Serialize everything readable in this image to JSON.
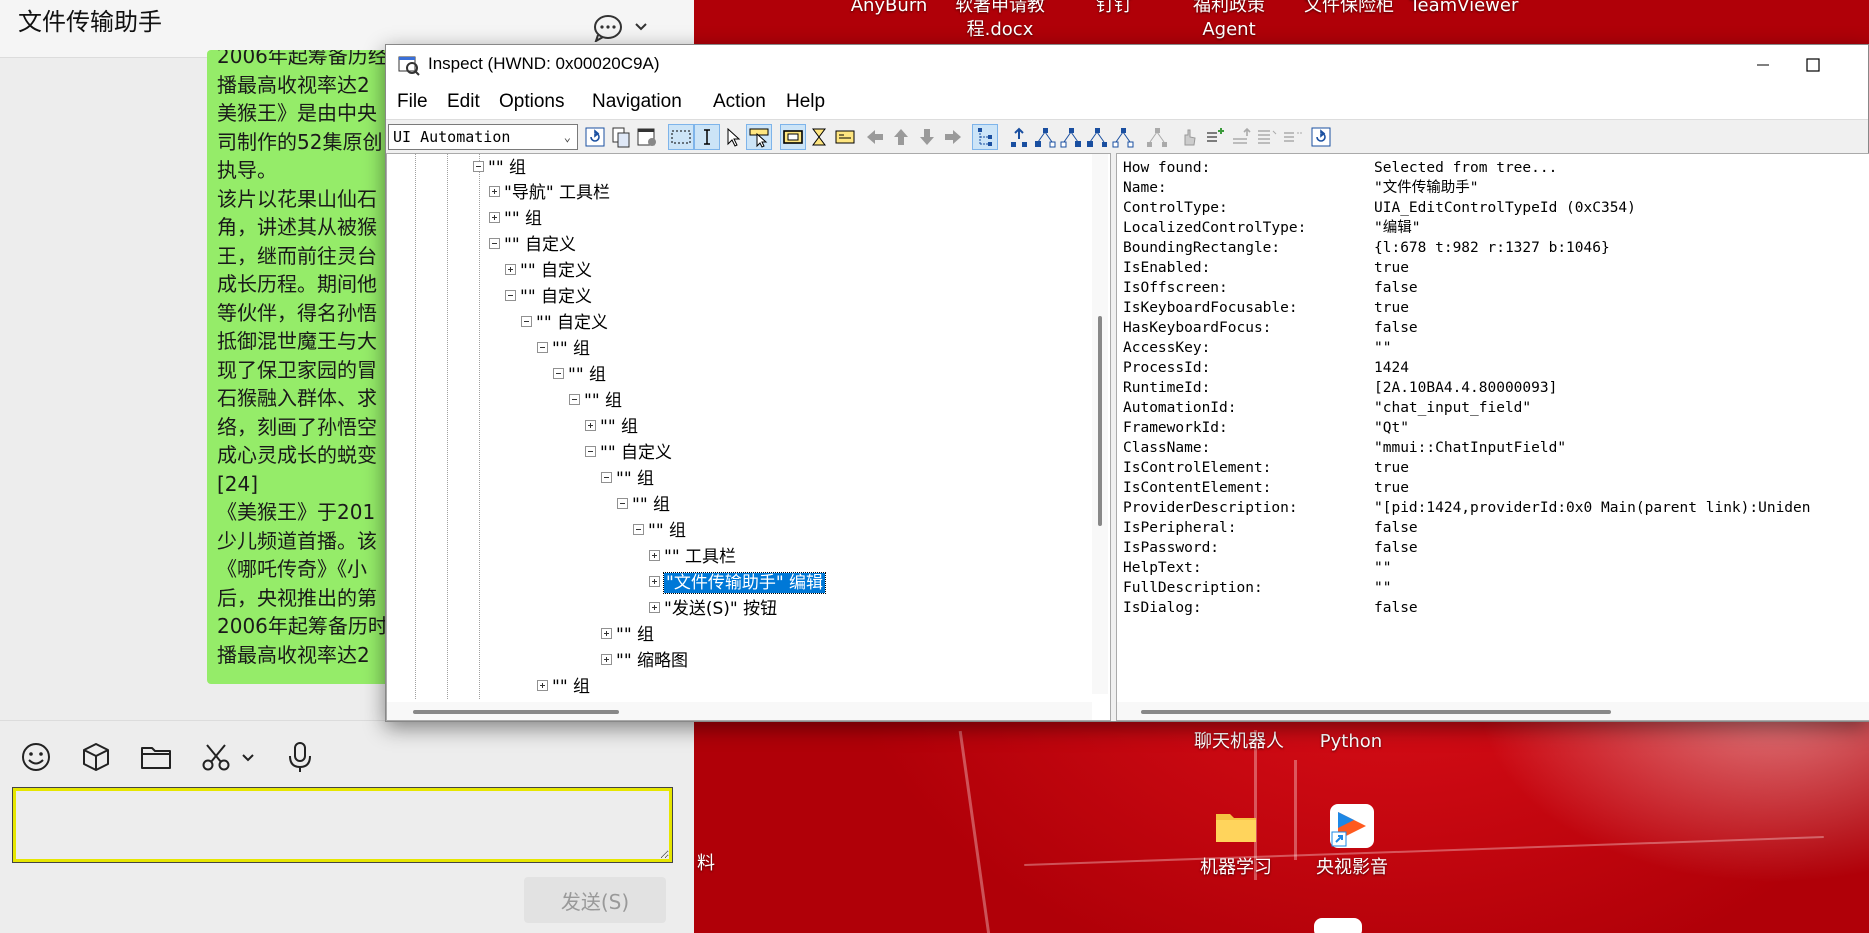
{
  "desktop": {
    "top_labels": [
      "AnyBurn",
      "软著申请教\n程.docx",
      "钉钉",
      "福利政策\nAgent",
      "文件保险柜",
      "TeamViewer"
    ],
    "mid_labels": [
      "聊天机器人",
      "Python"
    ],
    "icons": [
      {
        "label": "机器学习",
        "icon": "folder-icon"
      },
      {
        "label": "央视影音",
        "icon": "cctv-video-icon"
      }
    ],
    "partial_label": "料"
  },
  "chat": {
    "title": "文件传输助手",
    "message_text": "2006年起筹备历经\n播最高收视率达2\n美猴王》是由中央\n司制作的52集原创\n执导。\n该片以花果山仙石\n角，讲述其从被猴\n王，继而前往灵台\n成长历程。期间他\n等伙伴，得名孙悟\n抵御混世魔王与大\n现了保卫家园的冒\n石猴融入群体、求\n络，刻画了孙悟空\n成心灵成长的蜕变\n[24]\n《美猴王》于201\n少儿频道首播。该\n《哪吒传奇》《小\n后，央视推出的第\n2006年起筹备历时\n播最高收视率达2",
    "tools": [
      "emoji-icon",
      "cube-icon",
      "folder-icon",
      "scissors-icon",
      "microphone-icon"
    ],
    "input_value": "",
    "send_label": "发送(S)"
  },
  "inspect": {
    "title": "Inspect  (HWND: 0x00020C9A)",
    "menu": [
      "File",
      "Edit",
      "Options",
      "Navigation",
      "Action",
      "Help"
    ],
    "mode": "UI Automation",
    "tree": [
      {
        "label": "\"\" 组",
        "exp": "minus"
      },
      {
        "label": "\"导航\" 工具栏",
        "exp": "plus"
      },
      {
        "label": "\"\" 组",
        "exp": "plus"
      },
      {
        "label": "\"\" 自定义",
        "exp": "minus"
      },
      {
        "label": "\"\" 自定义",
        "exp": "plus"
      },
      {
        "label": "\"\" 自定义",
        "exp": "minus"
      },
      {
        "label": "\"\" 自定义",
        "exp": "minus"
      },
      {
        "label": "\"\" 组",
        "exp": "minus"
      },
      {
        "label": "\"\" 组",
        "exp": "minus"
      },
      {
        "label": "\"\" 组",
        "exp": "minus"
      },
      {
        "label": "\"\" 组",
        "exp": "plus"
      },
      {
        "label": "\"\" 自定义",
        "exp": "minus"
      },
      {
        "label": "\"\" 组",
        "exp": "minus"
      },
      {
        "label": "\"\" 组",
        "exp": "minus"
      },
      {
        "label": "\"\" 组",
        "exp": "minus"
      },
      {
        "label": "\"\" 工具栏",
        "exp": "plus"
      },
      {
        "label": "\"文件传输助手\" 编辑",
        "exp": "plus",
        "selected": true
      },
      {
        "label": "\"发送(S)\" 按钮",
        "exp": "plus"
      },
      {
        "label": "\"\" 组",
        "exp": "plus"
      },
      {
        "label": "\"\" 缩略图",
        "exp": "plus"
      },
      {
        "label": "\"\" 组",
        "exp": "plus"
      }
    ],
    "properties": [
      [
        "How found:",
        "Selected from tree..."
      ],
      [
        "Name:",
        "\"文件传输助手\""
      ],
      [
        "ControlType:",
        "UIA_EditControlTypeId (0xC354)"
      ],
      [
        "LocalizedControlType:",
        "\"编辑\""
      ],
      [
        "BoundingRectangle:",
        "{l:678 t:982 r:1327 b:1046}"
      ],
      [
        "IsEnabled:",
        "true"
      ],
      [
        "IsOffscreen:",
        "false"
      ],
      [
        "IsKeyboardFocusable:",
        "true"
      ],
      [
        "HasKeyboardFocus:",
        "false"
      ],
      [
        "AccessKey:",
        "\"\""
      ],
      [
        "ProcessId:",
        "1424"
      ],
      [
        "RuntimeId:",
        "[2A.10BA4.4.80000093]"
      ],
      [
        "AutomationId:",
        "\"chat_input_field\""
      ],
      [
        "FrameworkId:",
        "\"Qt\""
      ],
      [
        "ClassName:",
        "\"mmui::ChatInputField\""
      ],
      [
        "IsControlElement:",
        "true"
      ],
      [
        "IsContentElement:",
        "true"
      ],
      [
        "ProviderDescription:",
        "\"[pid:1424,providerId:0x0 Main(parent link):Uniden"
      ],
      [
        "IsPeripheral:",
        "false"
      ],
      [
        "IsPassword:",
        "false"
      ],
      [
        "HelpText:",
        "\"\""
      ],
      [
        "FullDescription:",
        "\"\""
      ],
      [
        "IsDialog:",
        "false"
      ]
    ]
  }
}
